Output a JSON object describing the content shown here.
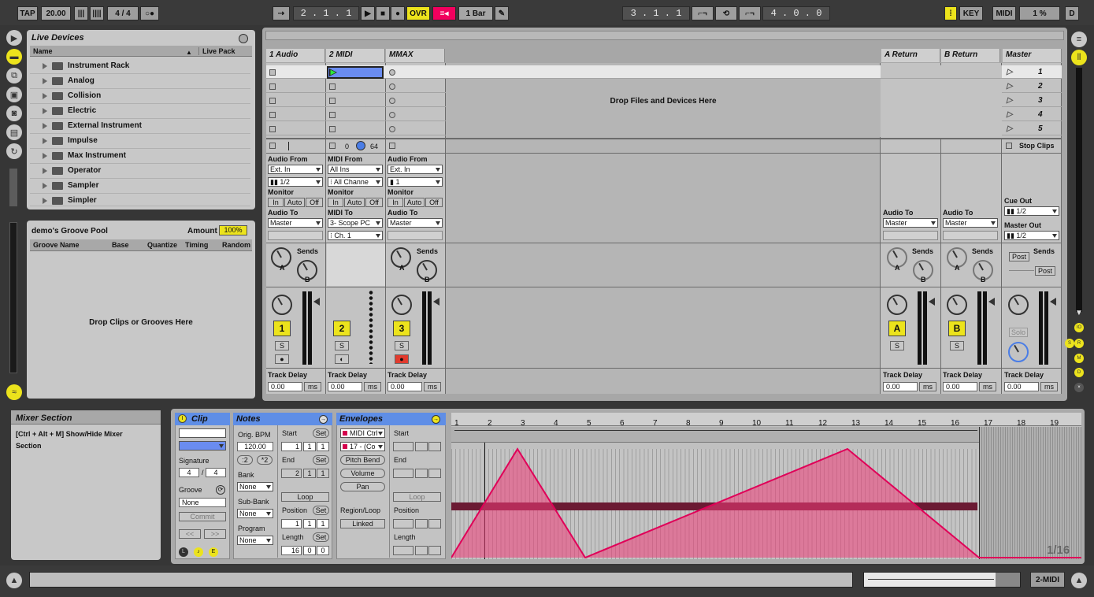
{
  "transport": {
    "tap": "TAP",
    "tempo": "20.00",
    "sig": "4 / 4",
    "position": "2 . 1 . 1",
    "ovr": "OVR",
    "quant": "1 Bar",
    "loop_start": "3 . 1 . 1",
    "loop_len": "4 . 0 . 0",
    "key": "KEY",
    "midi": "MIDI",
    "cpu": "1 %",
    "d": "D"
  },
  "browser": {
    "title": "Live Devices",
    "col_name": "Name",
    "col_pack": "Live Pack",
    "items": [
      "Instrument Rack",
      "Analog",
      "Collision",
      "Electric",
      "External Instrument",
      "Impulse",
      "Max Instrument",
      "Operator",
      "Sampler",
      "Simpler"
    ]
  },
  "groove": {
    "title": "demo's Groove Pool",
    "amount_label": "Amount",
    "amount": "100%",
    "cols": [
      "Groove Name",
      "Base",
      "Quantize",
      "Timing",
      "Random"
    ],
    "empty": "Drop Clips or Grooves Here"
  },
  "tracks": {
    "t1": "1 Audio",
    "t2": "2 MIDI",
    "t3": "MMAX",
    "ra": "A Return",
    "rb": "B Return",
    "master": "Master"
  },
  "session": {
    "drop": "Drop Files and Devices Here",
    "scenes": [
      "1",
      "2",
      "3",
      "4",
      "5"
    ],
    "stop_clips": "Stop Clips",
    "t2_val1": "0",
    "t2_val2": "64"
  },
  "io": {
    "audio_from": "Audio From",
    "ext_in": "Ext. In",
    "ch12": "1/2",
    "ch1": "1",
    "monitor": "Monitor",
    "in": "In",
    "auto": "Auto",
    "off": "Off",
    "audio_to": "Audio To",
    "master": "Master",
    "midi_from": "MIDI From",
    "all_ins": "All Ins",
    "all_ch": "All Channe",
    "midi_to": "MIDI To",
    "scope": "3- Scope PC",
    "ch_1": "Ch. 1",
    "cue_out": "Cue Out",
    "master_out": "Master Out",
    "mo_val": "1/2"
  },
  "mixer": {
    "sends": "Sends",
    "a": "A",
    "b": "B",
    "post": "Post",
    "solo": "Solo",
    "s": "S",
    "track_delay": "Track Delay",
    "delay_val": "0.00",
    "ms": "ms",
    "n1": "1",
    "n2": "2",
    "n3": "3",
    "na": "A",
    "nb": "B"
  },
  "info": {
    "title": "Mixer Section",
    "text1": "[Ctrl + Alt + M] Show/Hide Mixer",
    "text2": "Section"
  },
  "clip": {
    "title": "Clip",
    "signature": "Signature",
    "sig_n": "4",
    "sig_d": "4",
    "groove": "Groove",
    "groove_val": "None",
    "commit": "Commit",
    "prev": "<<",
    "next": ">>"
  },
  "notes": {
    "title": "Notes",
    "orig_bpm": "Orig. BPM",
    "bpm": "120.00",
    "half": ":2",
    "dbl": "*2",
    "bank": "Bank",
    "bank_val": "None",
    "subbank": "Sub-Bank",
    "subbank_val": "None",
    "program": "Program",
    "program_val": "None",
    "start": "Start",
    "set": "Set",
    "end": "End",
    "loop": "Loop",
    "position": "Position",
    "length": "Length",
    "s1": "1",
    "s2": "1",
    "s3": "1",
    "e1": "2",
    "e2": "1",
    "e3": "1",
    "p1": "1",
    "p2": "1",
    "p3": "1",
    "l1": "16",
    "l2": "0",
    "l3": "0"
  },
  "env": {
    "title": "Envelopes",
    "midi_ctrl": "MIDI Ctrl",
    "ctrl17": "17 - (Co",
    "pitch": "Pitch Bend",
    "volume": "Volume",
    "pan": "Pan",
    "region": "Region/Loop",
    "linked": "Linked",
    "start": "Start",
    "end": "End",
    "loop": "Loop",
    "position": "Position",
    "length": "Length"
  },
  "editor": {
    "grid": "1/16",
    "ruler": [
      "1",
      "2",
      "3",
      "4",
      "5",
      "6",
      "7",
      "8",
      "9",
      "10",
      "11",
      "12",
      "13",
      "14",
      "15",
      "16",
      "17",
      "18",
      "19"
    ]
  },
  "status": {
    "track": "2-MIDI"
  }
}
